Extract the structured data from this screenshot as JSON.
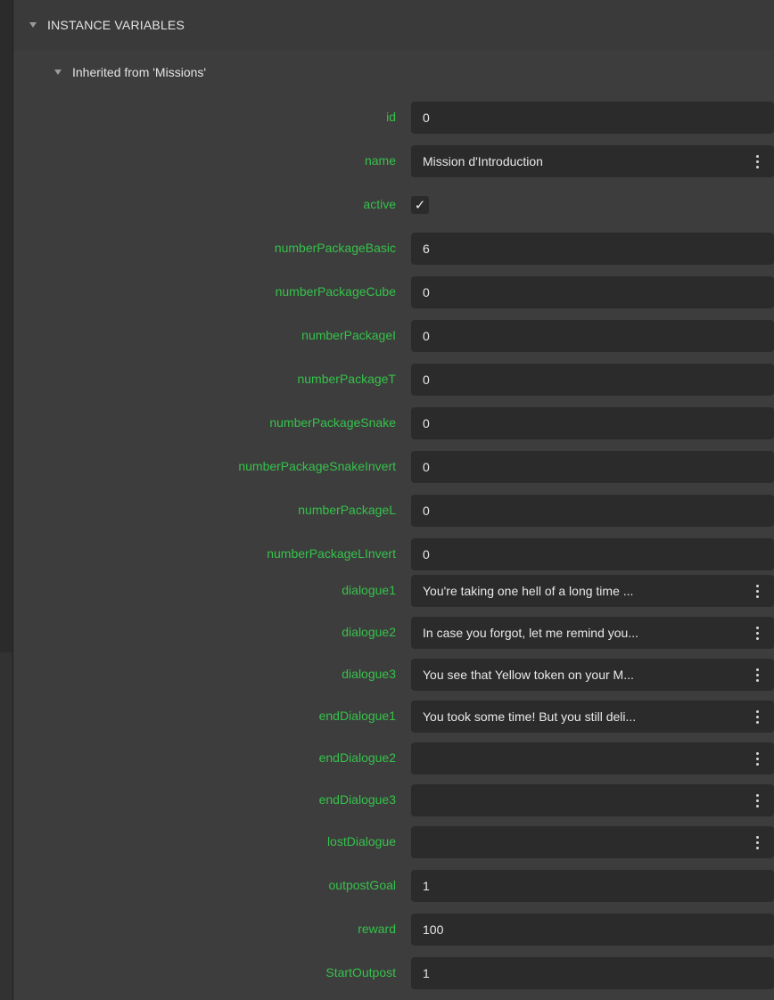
{
  "section": {
    "title": "INSTANCE VARIABLES"
  },
  "group": {
    "title": "Inherited from 'Missions'"
  },
  "rows": [
    {
      "label": "id",
      "value": "0"
    },
    {
      "label": "name",
      "value": "Mission d'Introduction"
    },
    {
      "label": "active",
      "value": "✓"
    },
    {
      "label": "numberPackageBasic",
      "value": "6"
    },
    {
      "label": "numberPackageCube",
      "value": "0"
    },
    {
      "label": "numberPackageI",
      "value": "0"
    },
    {
      "label": "numberPackageT",
      "value": "0"
    },
    {
      "label": "numberPackageSnake",
      "value": "0"
    },
    {
      "label": "numberPackageSnakeInvert",
      "value": "0"
    },
    {
      "label": "numberPackageL",
      "value": "0"
    },
    {
      "label": "numberPackageLInvert",
      "value": "0"
    },
    {
      "label": "dialogue1",
      "value": "You're taking one hell of a long time ..."
    },
    {
      "label": "dialogue2",
      "value": "In case you forgot, let me remind you..."
    },
    {
      "label": "dialogue3",
      "value": "You see that Yellow token on your M..."
    },
    {
      "label": "endDialogue1",
      "value": "You took some time! But you still deli..."
    },
    {
      "label": "endDialogue2",
      "value": ""
    },
    {
      "label": "endDialogue3",
      "value": ""
    },
    {
      "label": "lostDialogue",
      "value": ""
    },
    {
      "label": "outpostGoal",
      "value": "1"
    },
    {
      "label": "reward",
      "value": "100"
    },
    {
      "label": "StartOutpost",
      "value": "1"
    }
  ],
  "colors": {
    "label": "#35c24a",
    "field_bg": "#2b2b2b",
    "panel_bg": "#3d3d3d"
  }
}
